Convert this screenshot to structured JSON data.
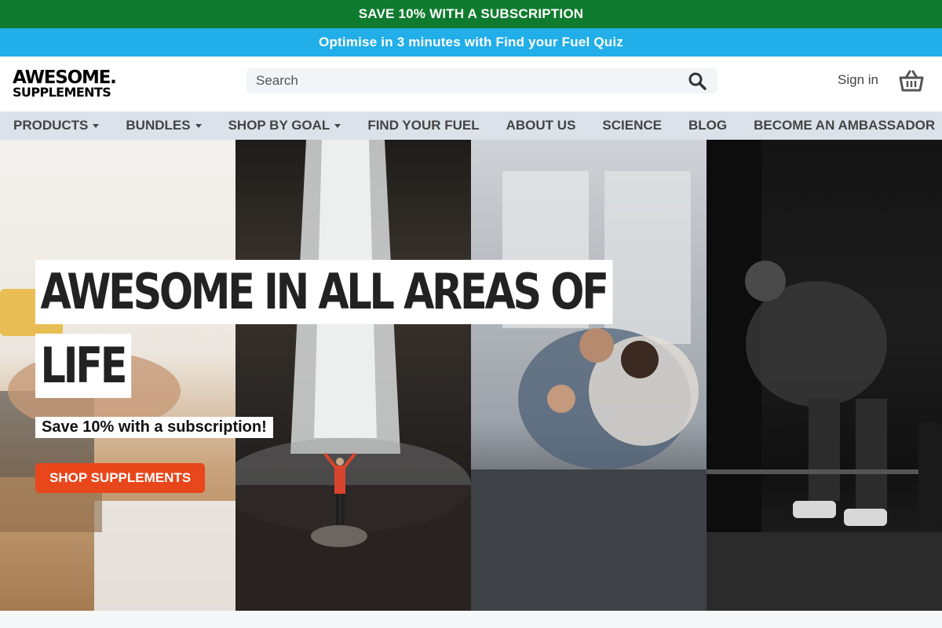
{
  "promo_top": "SAVE 10% WITH A SUBSCRIPTION",
  "promo_second": "Optimise in 3 minutes with Find your Fuel Quiz",
  "header": {
    "logo_line1": "AWESOME.",
    "logo_line2": "SUPPLEMENTS",
    "search_placeholder": "Search",
    "signin_label": "Sign in"
  },
  "nav": [
    {
      "label": "PRODUCTS",
      "has_dropdown": true
    },
    {
      "label": "BUNDLES",
      "has_dropdown": true
    },
    {
      "label": "SHOP BY GOAL",
      "has_dropdown": true
    },
    {
      "label": "FIND YOUR FUEL",
      "has_dropdown": false
    },
    {
      "label": "ABOUT US",
      "has_dropdown": false
    },
    {
      "label": "SCIENCE",
      "has_dropdown": false
    },
    {
      "label": "BLOG",
      "has_dropdown": false
    },
    {
      "label": "BECOME AN AMBASSADOR",
      "has_dropdown": false
    }
  ],
  "hero": {
    "headline_line1": "AWESOME IN ALL AREAS OF",
    "headline_line2": "LIFE",
    "subline": "Save 10% with a subscription!",
    "cta_label": "SHOP SUPPLEMENTS"
  },
  "colors": {
    "promo_green": "#0f7b2e",
    "promo_blue": "#22aee8",
    "nav_bg": "#dbe2ea",
    "cta": "#e8461b"
  }
}
